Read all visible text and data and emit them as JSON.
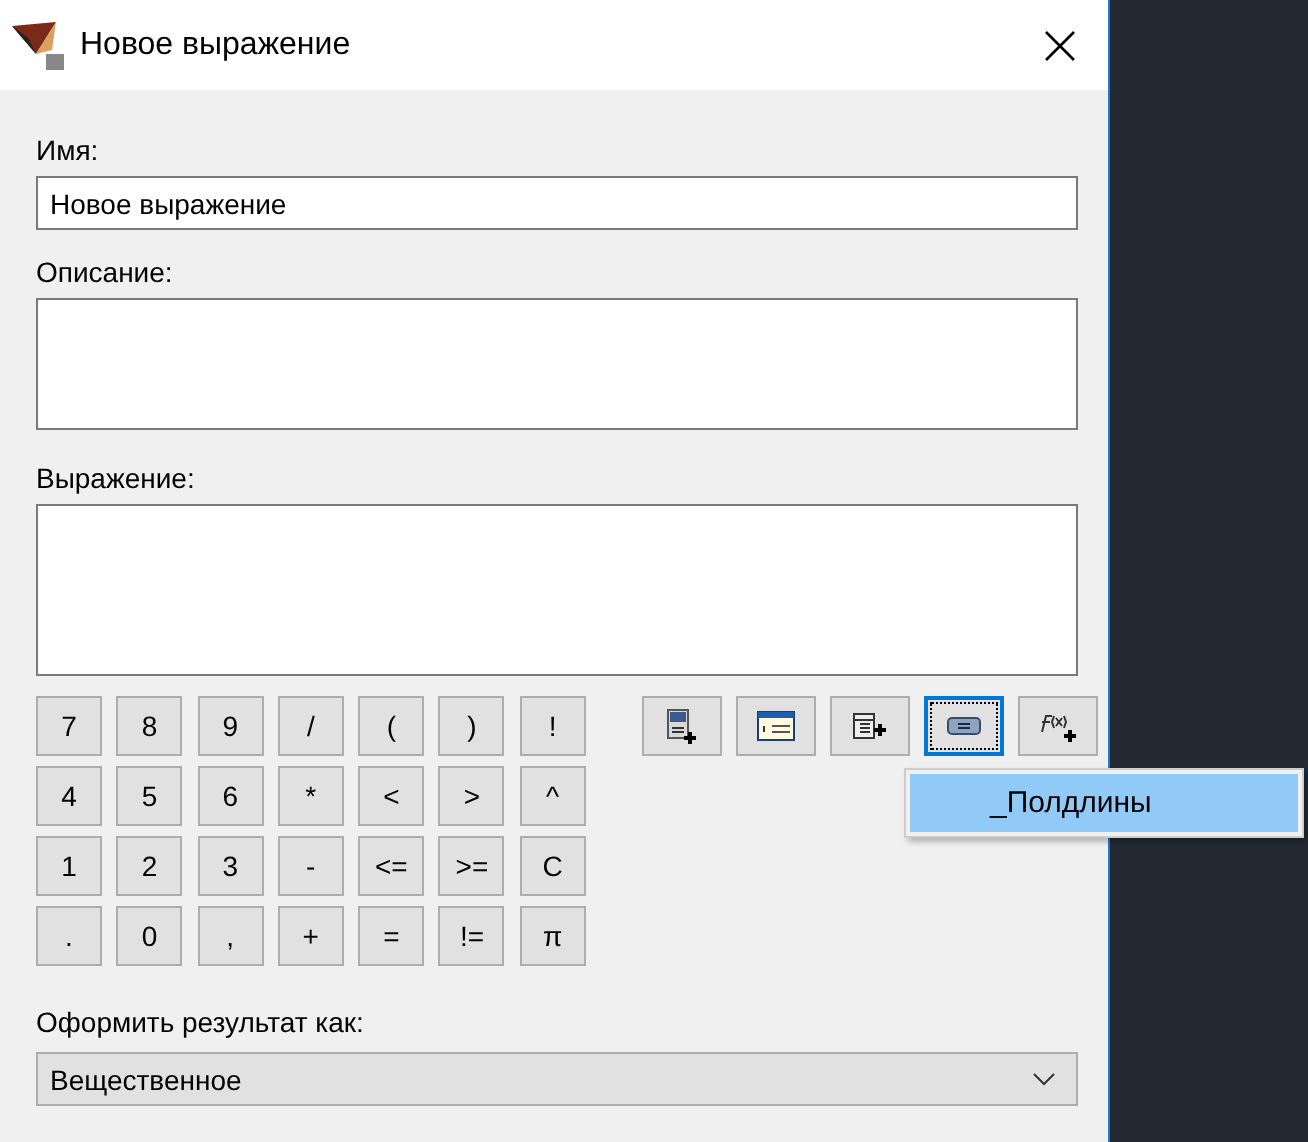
{
  "window": {
    "title": "Новое выражение"
  },
  "name": {
    "label": "Имя:",
    "value": "Новое выражение"
  },
  "description": {
    "label": "Описание:"
  },
  "expression": {
    "label": "Выражение:"
  },
  "keypad": [
    [
      "7",
      "8",
      "9",
      "/",
      "(",
      ")",
      "!"
    ],
    [
      "4",
      "5",
      "6",
      "*",
      "<",
      ">",
      "^"
    ],
    [
      "1",
      "2",
      "3",
      "-",
      "<=",
      ">=",
      "C"
    ],
    [
      ".",
      "0",
      ",",
      "+",
      "=",
      "!=",
      "π"
    ]
  ],
  "tools": [
    {
      "kind": "insert-variable",
      "selected": false
    },
    {
      "kind": "list",
      "selected": false
    },
    {
      "kind": "table",
      "selected": false
    },
    {
      "kind": "field",
      "selected": true
    },
    {
      "kind": "function",
      "selected": false
    }
  ],
  "popup": {
    "items": [
      {
        "label": "_Полдлины",
        "selected": true
      }
    ]
  },
  "result": {
    "label": "Оформить результат как:",
    "value": "Вещественное"
  }
}
